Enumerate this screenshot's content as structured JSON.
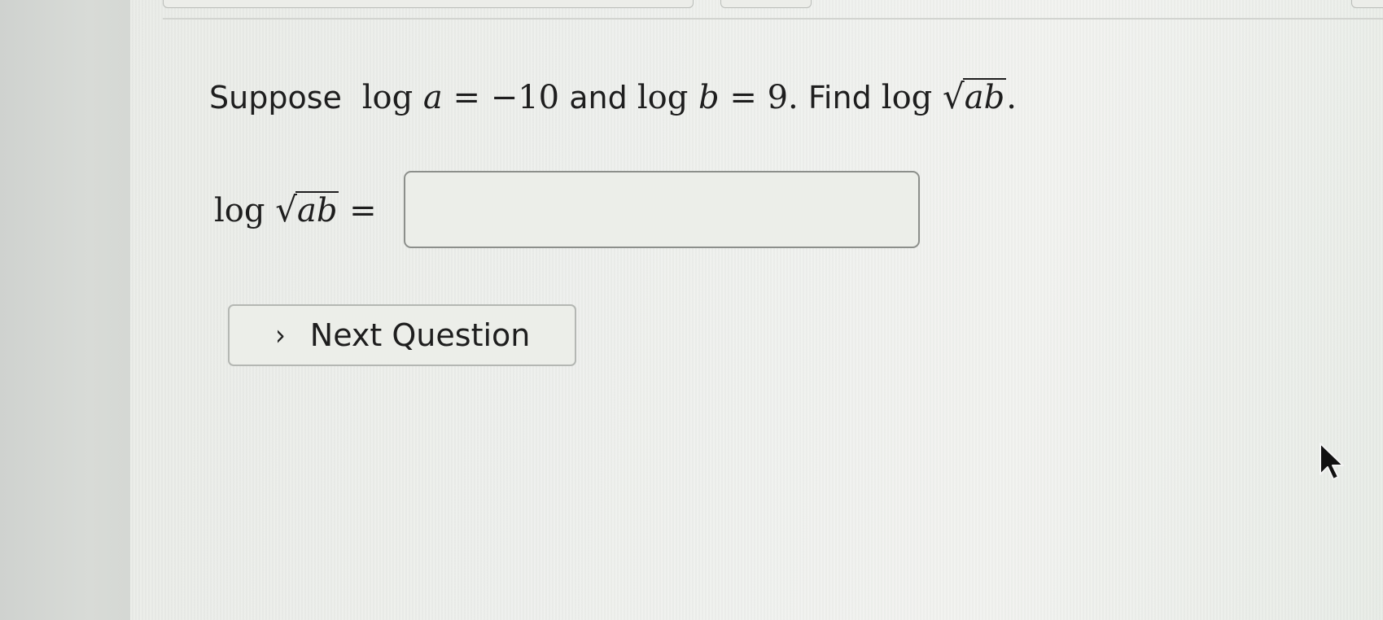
{
  "question": {
    "prefix": "Suppose",
    "log1": "log",
    "var_a": "a",
    "eq1": "=",
    "value_a": "−10",
    "connector": "and",
    "log2": "log",
    "var_b": "b",
    "eq2": "=",
    "value_b": "9",
    "period1": ".",
    "find": "Find",
    "log3": "log",
    "radicand": "ab",
    "period2": "."
  },
  "answer": {
    "label_log": "log",
    "label_radicand": "ab",
    "label_eq": "=",
    "input_value": "",
    "input_placeholder": ""
  },
  "next_button": {
    "label": "Next Question",
    "icon": "chevron-right-icon"
  },
  "colors": {
    "text": "#1e1e1e",
    "input_border": "#8c8f8b",
    "button_border": "#b4b7b3"
  }
}
